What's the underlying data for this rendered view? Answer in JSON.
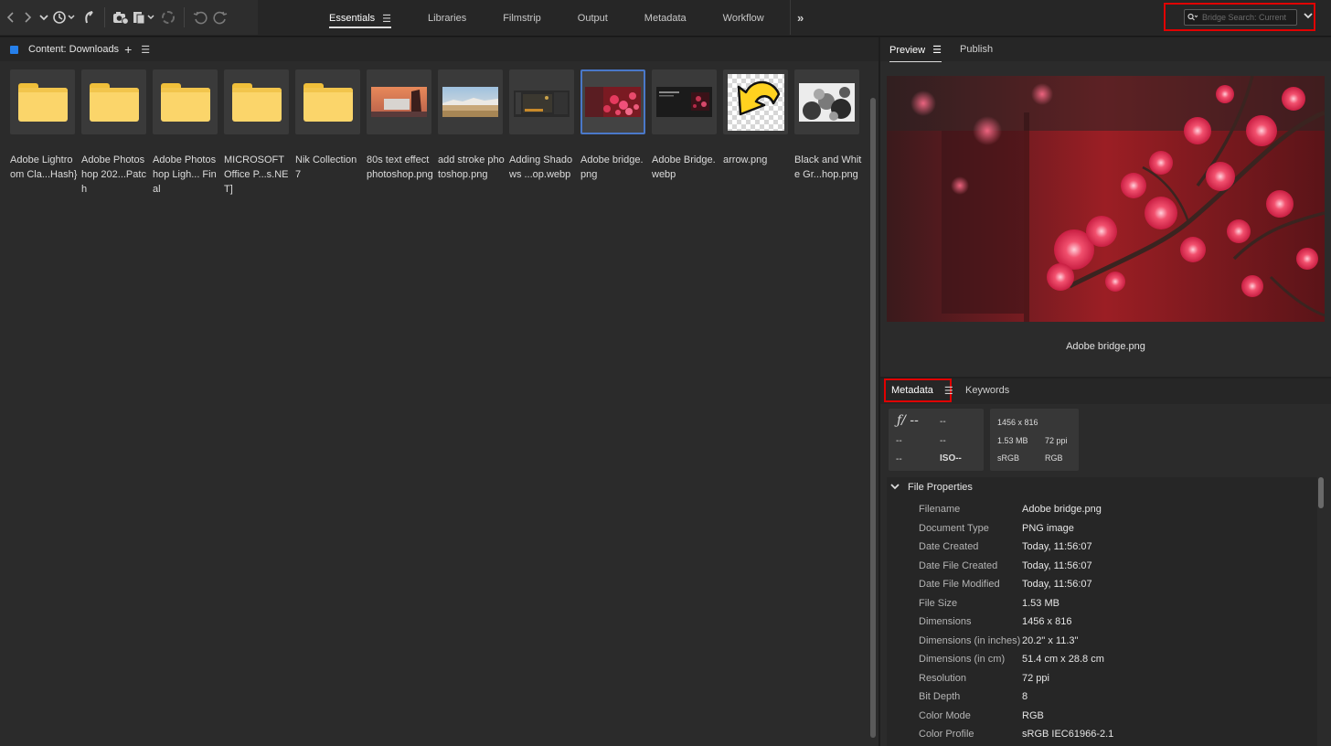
{
  "toolbar": {
    "icons": [
      "back-icon",
      "forward-icon",
      "chevron-down-icon",
      "recent-history-icon",
      "boomerang-icon",
      "camera-get-photos-icon",
      "refine-icon",
      "rotate-off-icon",
      "rotate-left-icon",
      "rotate-right-icon"
    ]
  },
  "workspace": {
    "tabs": [
      "Essentials",
      "Libraries",
      "Filmstrip",
      "Output",
      "Metadata",
      "Workflow"
    ],
    "active": "Essentials"
  },
  "search": {
    "placeholder": "Bridge Search: Current"
  },
  "content": {
    "title": "Content: Downloads",
    "items": [
      {
        "type": "folder",
        "label": "Adobe Lightroom Cla...Hash}"
      },
      {
        "type": "folder",
        "label": "Adobe Photoshop 202...Patch"
      },
      {
        "type": "folder",
        "label": "Adobe Photoshop Ligh... Final"
      },
      {
        "type": "folder",
        "label": "MICROSOFT Office P...s.NET]"
      },
      {
        "type": "folder",
        "label": "Nik Collection 7"
      },
      {
        "type": "image",
        "label": "80s text effect photoshop.png"
      },
      {
        "type": "image",
        "label": "add stroke photoshop.png"
      },
      {
        "type": "image",
        "label": "Adding Shadows ...op.webp"
      },
      {
        "type": "image",
        "label": "Adobe bridge.png",
        "selected": true
      },
      {
        "type": "image",
        "label": "Adobe Bridge.webp"
      },
      {
        "type": "image",
        "label": "arrow.png"
      },
      {
        "type": "image",
        "label": "Black and White Gr...hop.png"
      }
    ]
  },
  "preview": {
    "tabs": [
      "Preview",
      "Publish"
    ],
    "active": "Preview",
    "filename": "Adobe bridge.png"
  },
  "metadata": {
    "tabs": [
      "Metadata",
      "Keywords"
    ],
    "active": "Metadata",
    "camera": {
      "aperture": "ƒ/ --",
      "shutter": "--",
      "r2c1": "--",
      "r2c2": "--",
      "r3c1": "--",
      "iso": "ISO--"
    },
    "image": {
      "dimensions": "1456 x 816",
      "size": "1.53 MB",
      "ppi": "72 ppi",
      "profile": "sRGB",
      "mode": "RGB"
    },
    "file_properties_label": "File Properties",
    "file_properties": [
      {
        "key": "Filename",
        "value": "Adobe bridge.png"
      },
      {
        "key": "Document Type",
        "value": "PNG image"
      },
      {
        "key": "Date Created",
        "value": "Today, 11:56:07"
      },
      {
        "key": "Date File Created",
        "value": "Today, 11:56:07"
      },
      {
        "key": "Date File Modified",
        "value": "Today, 11:56:07"
      },
      {
        "key": "File Size",
        "value": "1.53 MB"
      },
      {
        "key": "Dimensions",
        "value": "1456 x 816"
      },
      {
        "key": "Dimensions (in inches)",
        "value": "20.2\" x 11.3\""
      },
      {
        "key": "Dimensions (in cm)",
        "value": "51.4 cm x 28.8 cm"
      },
      {
        "key": "Resolution",
        "value": "72 ppi"
      },
      {
        "key": "Bit Depth",
        "value": "8"
      },
      {
        "key": "Color Mode",
        "value": "RGB"
      },
      {
        "key": "Color Profile",
        "value": "sRGB IEC61966-2.1"
      }
    ]
  },
  "colors": {
    "accent_blue": "#2680eb",
    "highlight_red": "#e00000",
    "folder_yellow": "#fbd56a"
  }
}
